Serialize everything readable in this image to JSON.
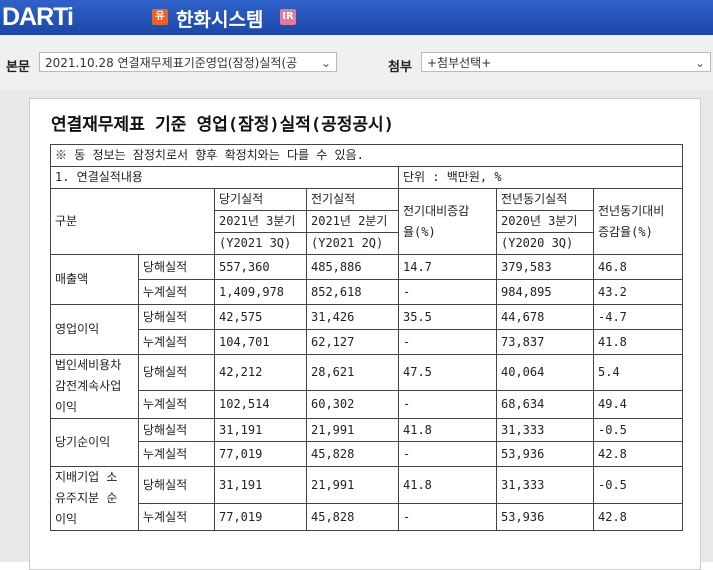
{
  "header": {
    "logo": "DARTi",
    "company": "한화시스템",
    "badge_left": "유",
    "badge_right": "IR"
  },
  "selectors": {
    "report_label": "본문",
    "report_value": "2021.10.28  연결재무제표기준영업(잠정)실적(공",
    "attach_label": "첨부",
    "attach_value": "+첨부선택+"
  },
  "doc": {
    "title": "연결재무제표 기준 영업(잠정)실적(공정공시)",
    "notice": "※ 동 정보는 잠정치로서 향후 확정치와는 다를 수 있음.",
    "section_label": "1. 연결실적내용",
    "unit": "단위 : 백만원, %",
    "headers": {
      "category": "구분",
      "current_period": "당기실적",
      "current_q": "2021년 3분기",
      "current_code": "(Y2021 3Q)",
      "prior_period": "전기실적",
      "prior_q": "2021년 2분기",
      "prior_code": "(Y2021 2Q)",
      "qoq_a": "전기대비증감",
      "qoq_b": "율(%)",
      "yoy_period": "전년동기실적",
      "yoy_q": "2020년 3분기",
      "yoy_code": "(Y2020 3Q)",
      "yoy_rate_a": "전년동기대비",
      "yoy_rate_b": "증감율(%)"
    },
    "rows": [
      {
        "item": [
          "매출액"
        ],
        "sub": [
          {
            "type": "당해실적",
            "cur": "557,360",
            "prev": "485,886",
            "qoq": "14.7",
            "yoy": "379,583",
            "yoy_rate": "46.8"
          },
          {
            "type": "누계실적",
            "cur": "1,409,978",
            "prev": "852,618",
            "qoq": "-",
            "yoy": "984,895",
            "yoy_rate": "43.2"
          }
        ]
      },
      {
        "item": [
          "영업이익"
        ],
        "sub": [
          {
            "type": "당해실적",
            "cur": "42,575",
            "prev": "31,426",
            "qoq": "35.5",
            "yoy": "44,678",
            "yoy_rate": "-4.7"
          },
          {
            "type": "누계실적",
            "cur": "104,701",
            "prev": "62,127",
            "qoq": "-",
            "yoy": "73,837",
            "yoy_rate": "41.8"
          }
        ]
      },
      {
        "item": [
          "법인세비용차",
          "감전계속사업",
          "이익"
        ],
        "sub": [
          {
            "type": "당해실적",
            "cur": "42,212",
            "prev": "28,621",
            "qoq": "47.5",
            "yoy": "40,064",
            "yoy_rate": "5.4"
          },
          {
            "type": "누계실적",
            "cur": "102,514",
            "prev": "60,302",
            "qoq": "-",
            "yoy": "68,634",
            "yoy_rate": "49.4"
          }
        ]
      },
      {
        "item": [
          "당기순이익"
        ],
        "sub": [
          {
            "type": "당해실적",
            "cur": "31,191",
            "prev": "21,991",
            "qoq": "41.8",
            "yoy": "31,333",
            "yoy_rate": "-0.5"
          },
          {
            "type": "누계실적",
            "cur": "77,019",
            "prev": "45,828",
            "qoq": "-",
            "yoy": "53,936",
            "yoy_rate": "42.8"
          }
        ]
      },
      {
        "item": [
          "지배기업 소",
          "유주지분 순",
          "이익"
        ],
        "sub": [
          {
            "type": "당해실적",
            "cur": "31,191",
            "prev": "21,991",
            "qoq": "41.8",
            "yoy": "31,333",
            "yoy_rate": "-0.5"
          },
          {
            "type": "누계실적",
            "cur": "77,019",
            "prev": "45,828",
            "qoq": "-",
            "yoy": "53,936",
            "yoy_rate": "42.8"
          }
        ]
      }
    ]
  }
}
